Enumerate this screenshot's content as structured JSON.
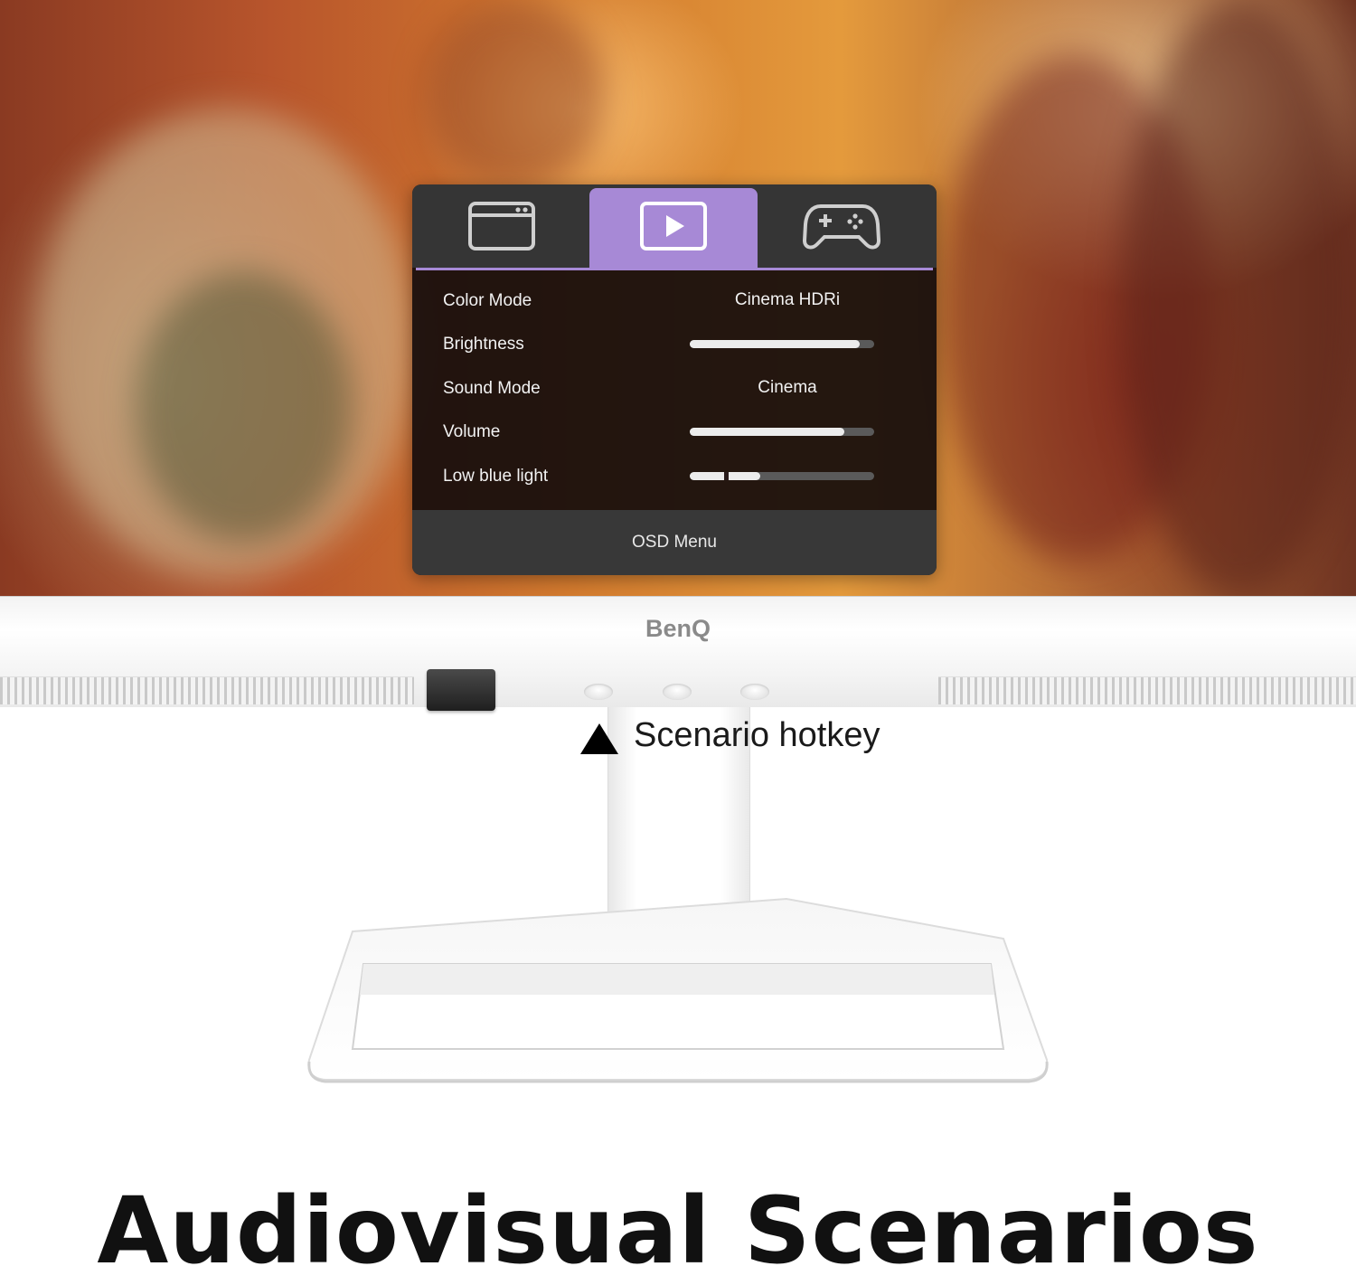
{
  "osd": {
    "tabs": [
      {
        "icon": "window-icon",
        "active": false
      },
      {
        "icon": "play-icon",
        "active": true
      },
      {
        "icon": "gamepad-icon",
        "active": false
      }
    ],
    "rows": [
      {
        "label": "Color Mode",
        "value": "Cinema HDRi"
      },
      {
        "label": "Brightness",
        "level": 0.92
      },
      {
        "label": "Sound Mode",
        "value": "Cinema"
      },
      {
        "label": "Volume",
        "level": 0.84
      },
      {
        "label": "Low blue light",
        "level": 0.38
      }
    ],
    "footer": "OSD Menu",
    "accent_color": "#a789d6"
  },
  "monitor": {
    "brand_logo": "BenQ"
  },
  "annotation": {
    "hotkey_label": "Scenario hotkey"
  },
  "headline": "Audiovisual Scenarios"
}
